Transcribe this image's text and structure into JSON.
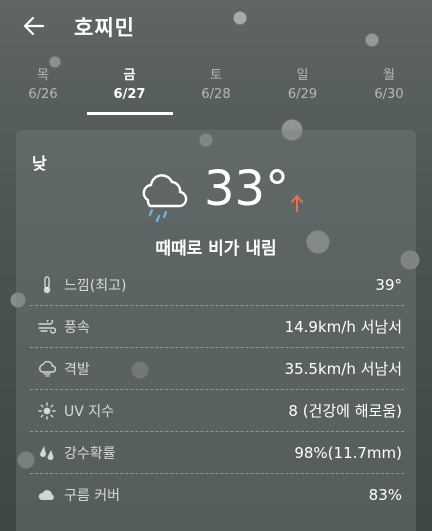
{
  "header": {
    "back_icon": "arrow-left-icon",
    "title": "호찌민"
  },
  "days": [
    {
      "name": "목",
      "date": "6/26",
      "active": false
    },
    {
      "name": "금",
      "date": "6/27",
      "active": true
    },
    {
      "name": "토",
      "date": "6/28",
      "active": false
    },
    {
      "name": "일",
      "date": "6/29",
      "active": false
    },
    {
      "name": "월",
      "date": "6/30",
      "active": false
    }
  ],
  "forecast": {
    "period": "낮",
    "weather_icon": "cloud-rain-icon",
    "temperature": "33°",
    "trend_icon": "arrow-up-icon",
    "trend_color": "#e8734e",
    "condition": "때때로 비가 내림",
    "details": [
      {
        "icon": "thermometer-icon",
        "label": "느낌(최고)",
        "value": "39°"
      },
      {
        "icon": "wind-icon",
        "label": "풍속",
        "value": "14.9km/h 서남서"
      },
      {
        "icon": "gust-icon",
        "label": "격발",
        "value": "35.5km/h 서남서"
      },
      {
        "icon": "sun-icon",
        "label": "UV 지수",
        "value": "8 (건강에 해로움)"
      },
      {
        "icon": "raindrops-icon",
        "label": "강수확률",
        "value": "98%(11.7mm)"
      },
      {
        "icon": "cloud-icon",
        "label": "구름 커버",
        "value": "83%"
      }
    ]
  }
}
